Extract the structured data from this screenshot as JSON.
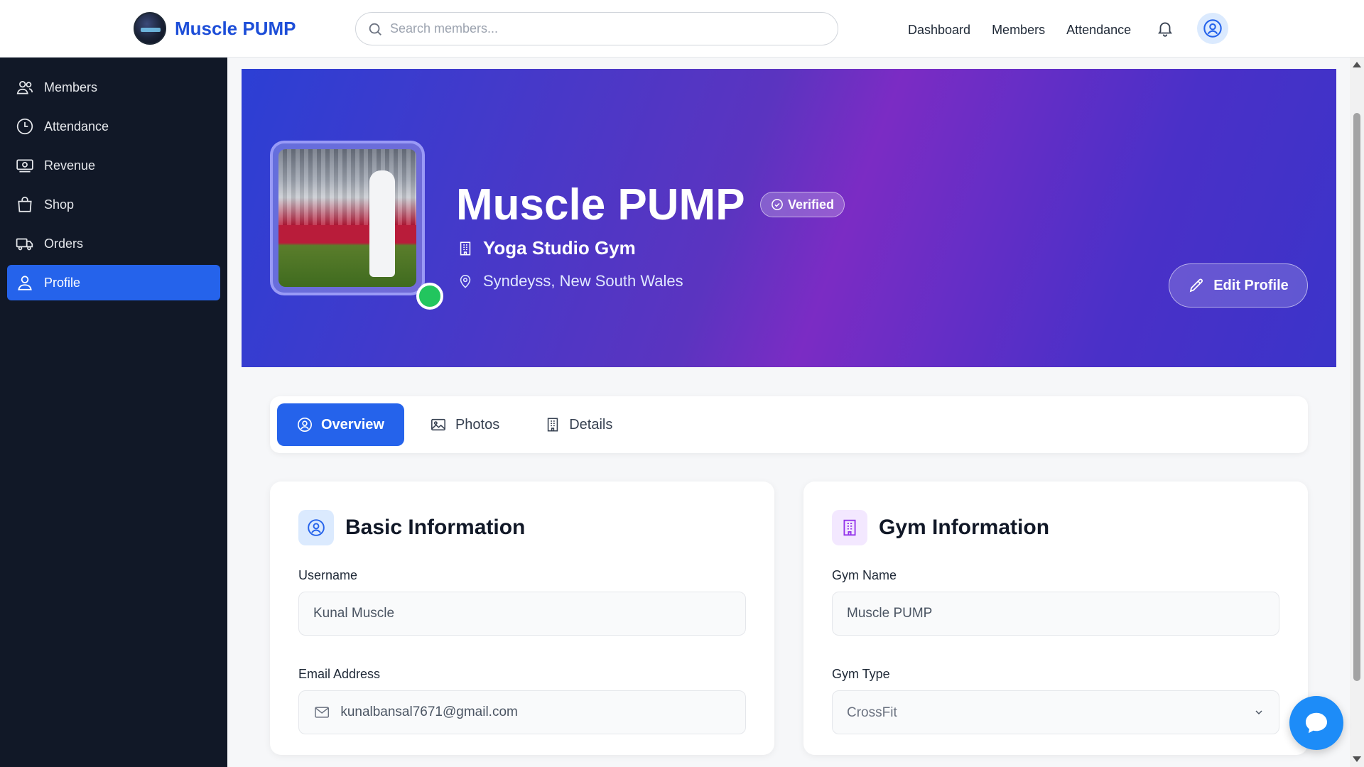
{
  "brand": {
    "name": "Muscle PUMP"
  },
  "search": {
    "placeholder": "Search members..."
  },
  "topnav": {
    "items": [
      "Dashboard",
      "Members",
      "Attendance"
    ]
  },
  "sidebar": {
    "items": [
      {
        "label": "Members",
        "icon": "users-icon",
        "active": false
      },
      {
        "label": "Attendance",
        "icon": "clock-icon",
        "active": false
      },
      {
        "label": "Revenue",
        "icon": "cash-icon",
        "active": false
      },
      {
        "label": "Shop",
        "icon": "shopping-bag-icon",
        "active": false
      },
      {
        "label": "Orders",
        "icon": "truck-icon",
        "active": false
      },
      {
        "label": "Profile",
        "icon": "user-icon",
        "active": true
      }
    ]
  },
  "hero": {
    "title": "Muscle PUMP",
    "badge": "Verified",
    "gym_type_line": "Yoga Studio Gym",
    "location": "Syndeyss, New South Wales",
    "edit_button": "Edit Profile",
    "status": "online"
  },
  "tabs": [
    {
      "label": "Overview",
      "active": true
    },
    {
      "label": "Photos",
      "active": false
    },
    {
      "label": "Details",
      "active": false
    }
  ],
  "basic_info": {
    "title": "Basic Information",
    "username_label": "Username",
    "username_value": "Kunal Muscle",
    "email_label": "Email Address",
    "email_value": "kunalbansal7671@gmail.com"
  },
  "gym_info": {
    "title": "Gym Information",
    "gym_name_label": "Gym Name",
    "gym_name_value": "Muscle PUMP",
    "gym_type_label": "Gym Type",
    "gym_type_value": "CrossFit"
  },
  "colors": {
    "brand": "#1d4ed8",
    "sidebar_bg": "#111827",
    "active": "#2563eb",
    "online": "#22c55e"
  }
}
